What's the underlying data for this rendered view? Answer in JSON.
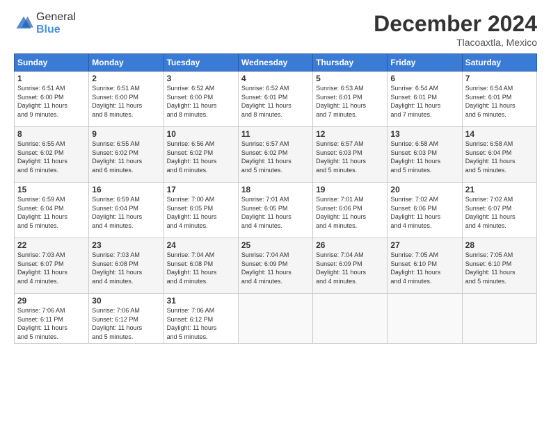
{
  "logo": {
    "text_general": "General",
    "text_blue": "Blue"
  },
  "header": {
    "month": "December 2024",
    "location": "Tlacoaxtla, Mexico"
  },
  "weekdays": [
    "Sunday",
    "Monday",
    "Tuesday",
    "Wednesday",
    "Thursday",
    "Friday",
    "Saturday"
  ],
  "weeks": [
    [
      {
        "day": 1,
        "info": "Sunrise: 6:51 AM\nSunset: 6:00 PM\nDaylight: 11 hours\nand 9 minutes."
      },
      {
        "day": 2,
        "info": "Sunrise: 6:51 AM\nSunset: 6:00 PM\nDaylight: 11 hours\nand 8 minutes."
      },
      {
        "day": 3,
        "info": "Sunrise: 6:52 AM\nSunset: 6:00 PM\nDaylight: 11 hours\nand 8 minutes."
      },
      {
        "day": 4,
        "info": "Sunrise: 6:52 AM\nSunset: 6:01 PM\nDaylight: 11 hours\nand 8 minutes."
      },
      {
        "day": 5,
        "info": "Sunrise: 6:53 AM\nSunset: 6:01 PM\nDaylight: 11 hours\nand 7 minutes."
      },
      {
        "day": 6,
        "info": "Sunrise: 6:54 AM\nSunset: 6:01 PM\nDaylight: 11 hours\nand 7 minutes."
      },
      {
        "day": 7,
        "info": "Sunrise: 6:54 AM\nSunset: 6:01 PM\nDaylight: 11 hours\nand 6 minutes."
      }
    ],
    [
      {
        "day": 8,
        "info": "Sunrise: 6:55 AM\nSunset: 6:02 PM\nDaylight: 11 hours\nand 6 minutes."
      },
      {
        "day": 9,
        "info": "Sunrise: 6:55 AM\nSunset: 6:02 PM\nDaylight: 11 hours\nand 6 minutes."
      },
      {
        "day": 10,
        "info": "Sunrise: 6:56 AM\nSunset: 6:02 PM\nDaylight: 11 hours\nand 6 minutes."
      },
      {
        "day": 11,
        "info": "Sunrise: 6:57 AM\nSunset: 6:02 PM\nDaylight: 11 hours\nand 5 minutes."
      },
      {
        "day": 12,
        "info": "Sunrise: 6:57 AM\nSunset: 6:03 PM\nDaylight: 11 hours\nand 5 minutes."
      },
      {
        "day": 13,
        "info": "Sunrise: 6:58 AM\nSunset: 6:03 PM\nDaylight: 11 hours\nand 5 minutes."
      },
      {
        "day": 14,
        "info": "Sunrise: 6:58 AM\nSunset: 6:04 PM\nDaylight: 11 hours\nand 5 minutes."
      }
    ],
    [
      {
        "day": 15,
        "info": "Sunrise: 6:59 AM\nSunset: 6:04 PM\nDaylight: 11 hours\nand 5 minutes."
      },
      {
        "day": 16,
        "info": "Sunrise: 6:59 AM\nSunset: 6:04 PM\nDaylight: 11 hours\nand 4 minutes."
      },
      {
        "day": 17,
        "info": "Sunrise: 7:00 AM\nSunset: 6:05 PM\nDaylight: 11 hours\nand 4 minutes."
      },
      {
        "day": 18,
        "info": "Sunrise: 7:01 AM\nSunset: 6:05 PM\nDaylight: 11 hours\nand 4 minutes."
      },
      {
        "day": 19,
        "info": "Sunrise: 7:01 AM\nSunset: 6:06 PM\nDaylight: 11 hours\nand 4 minutes."
      },
      {
        "day": 20,
        "info": "Sunrise: 7:02 AM\nSunset: 6:06 PM\nDaylight: 11 hours\nand 4 minutes."
      },
      {
        "day": 21,
        "info": "Sunrise: 7:02 AM\nSunset: 6:07 PM\nDaylight: 11 hours\nand 4 minutes."
      }
    ],
    [
      {
        "day": 22,
        "info": "Sunrise: 7:03 AM\nSunset: 6:07 PM\nDaylight: 11 hours\nand 4 minutes."
      },
      {
        "day": 23,
        "info": "Sunrise: 7:03 AM\nSunset: 6:08 PM\nDaylight: 11 hours\nand 4 minutes."
      },
      {
        "day": 24,
        "info": "Sunrise: 7:04 AM\nSunset: 6:08 PM\nDaylight: 11 hours\nand 4 minutes."
      },
      {
        "day": 25,
        "info": "Sunrise: 7:04 AM\nSunset: 6:09 PM\nDaylight: 11 hours\nand 4 minutes."
      },
      {
        "day": 26,
        "info": "Sunrise: 7:04 AM\nSunset: 6:09 PM\nDaylight: 11 hours\nand 4 minutes."
      },
      {
        "day": 27,
        "info": "Sunrise: 7:05 AM\nSunset: 6:10 PM\nDaylight: 11 hours\nand 4 minutes."
      },
      {
        "day": 28,
        "info": "Sunrise: 7:05 AM\nSunset: 6:10 PM\nDaylight: 11 hours\nand 5 minutes."
      }
    ],
    [
      {
        "day": 29,
        "info": "Sunrise: 7:06 AM\nSunset: 6:11 PM\nDaylight: 11 hours\nand 5 minutes."
      },
      {
        "day": 30,
        "info": "Sunrise: 7:06 AM\nSunset: 6:12 PM\nDaylight: 11 hours\nand 5 minutes."
      },
      {
        "day": 31,
        "info": "Sunrise: 7:06 AM\nSunset: 6:12 PM\nDaylight: 11 hours\nand 5 minutes."
      },
      null,
      null,
      null,
      null
    ]
  ]
}
